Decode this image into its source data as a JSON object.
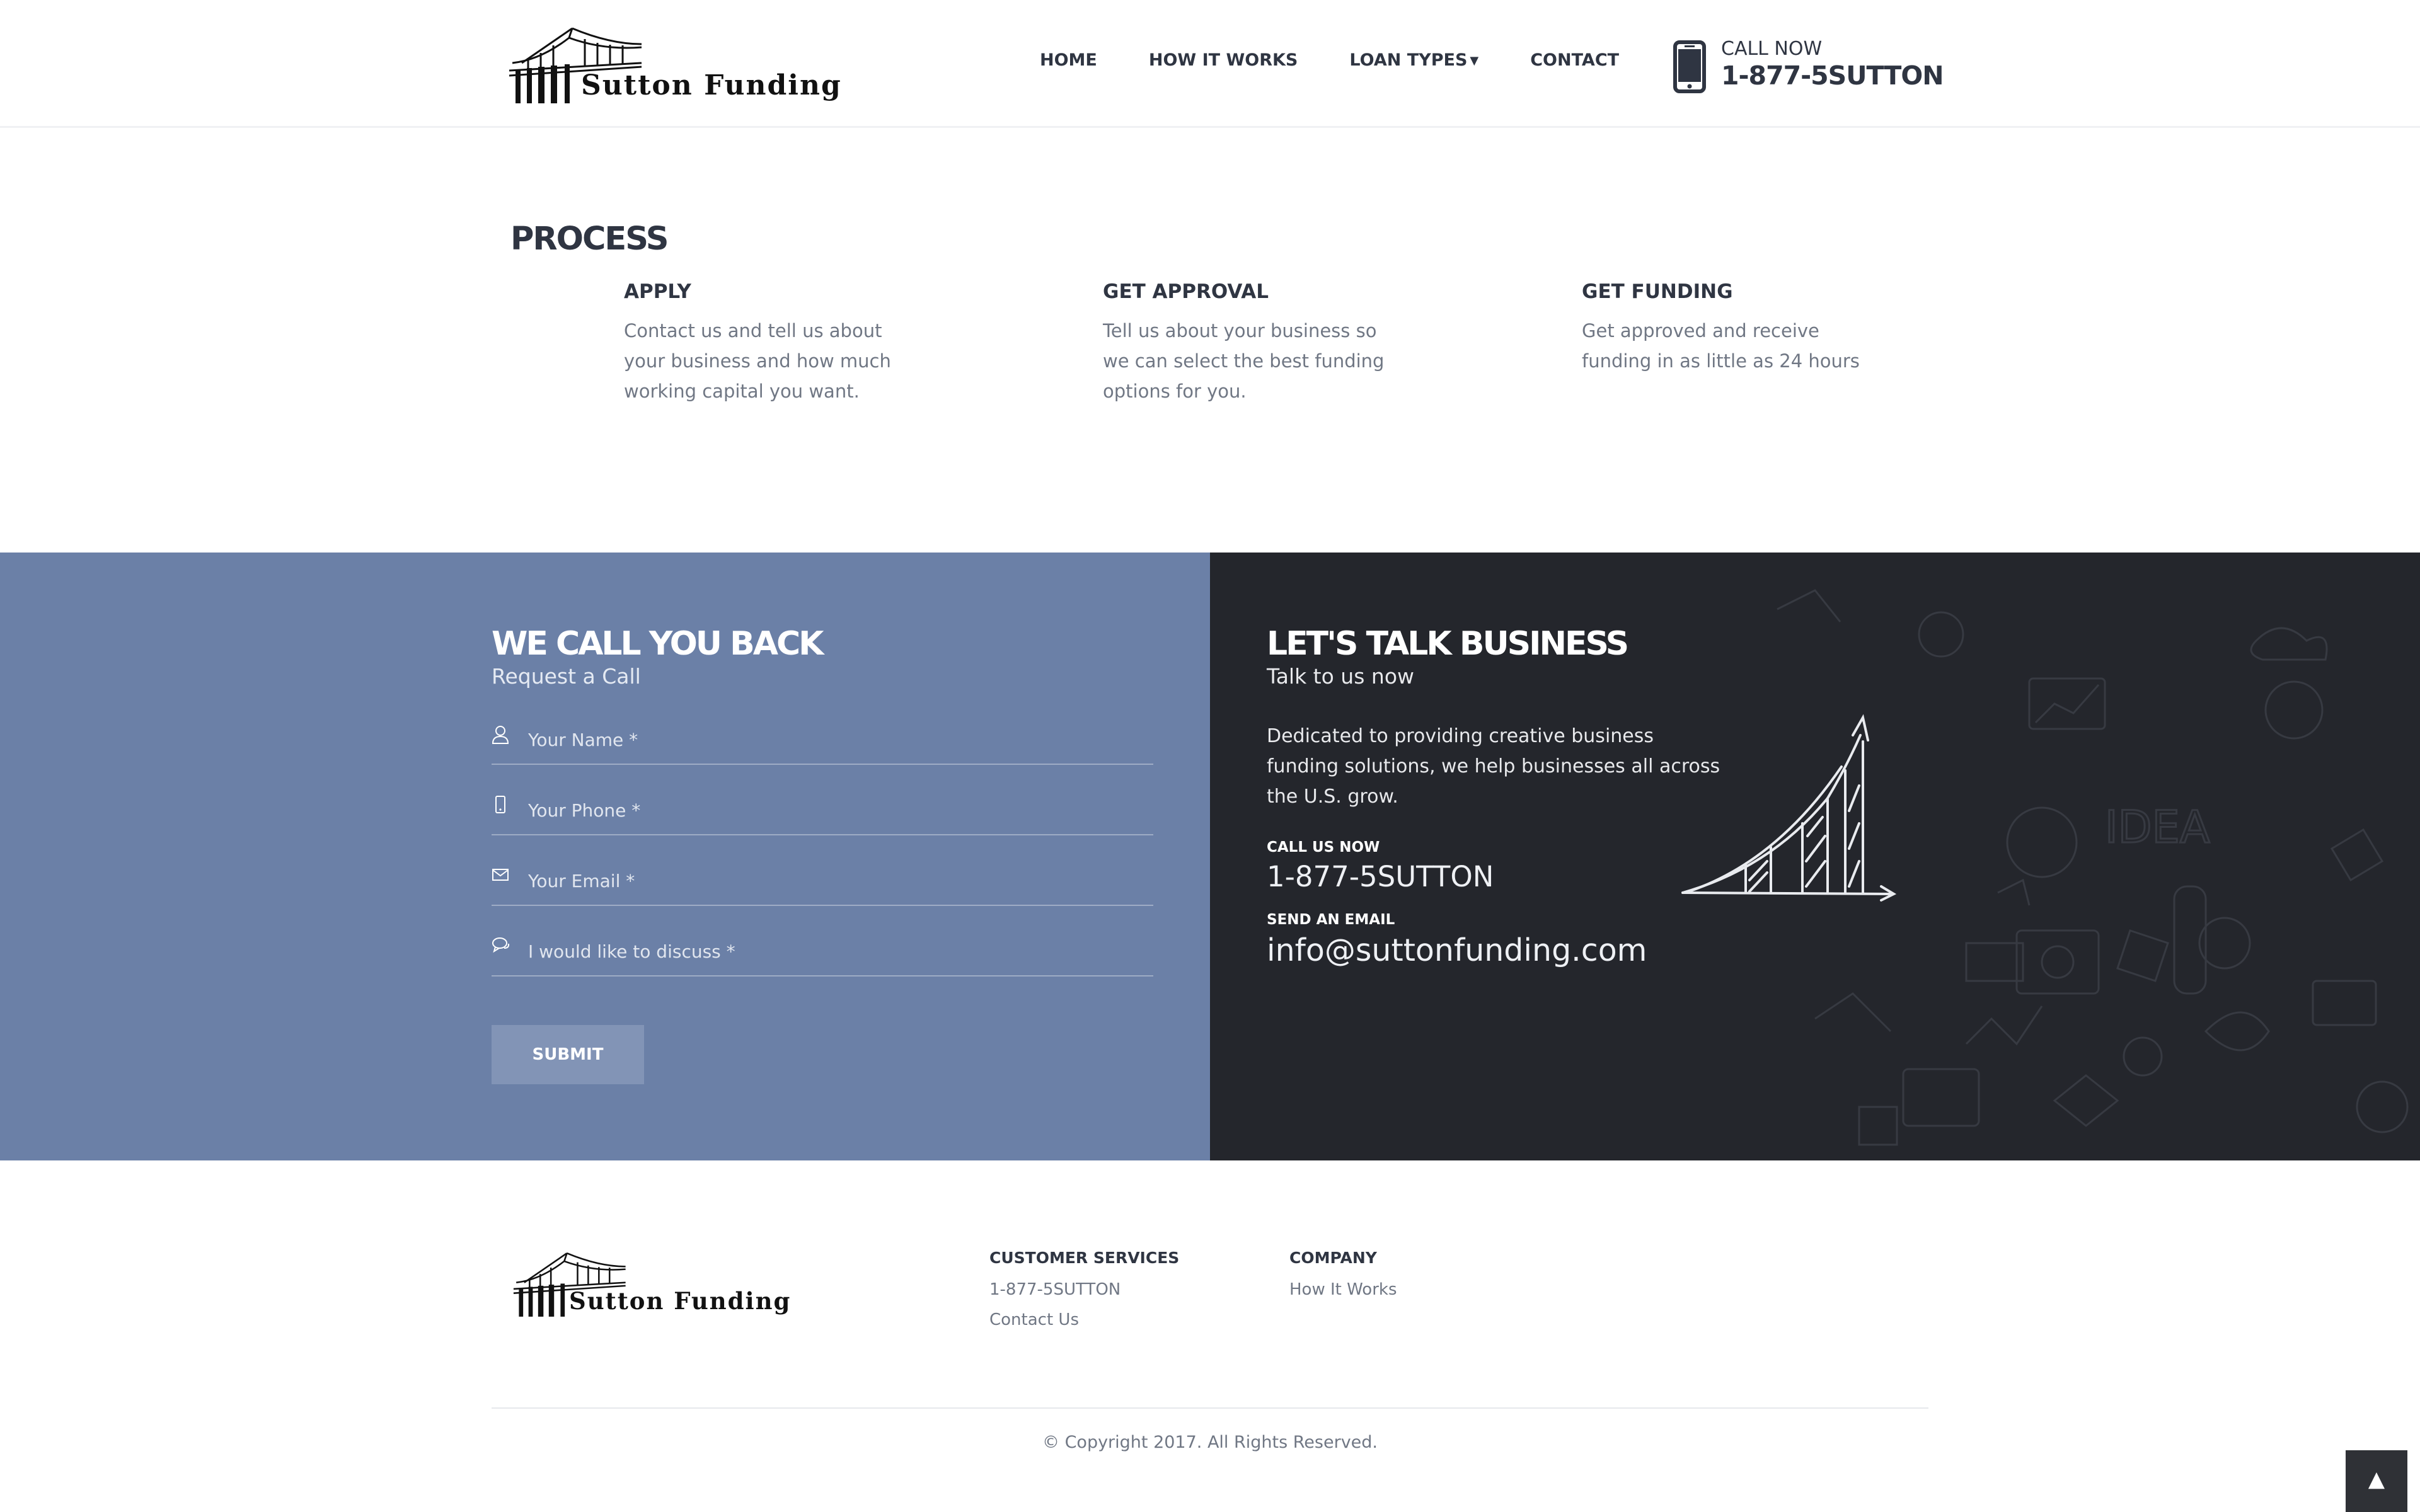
{
  "brand": {
    "name": "Sutton Funding"
  },
  "nav": {
    "items": [
      {
        "label": "HOME"
      },
      {
        "label": "HOW IT WORKS"
      },
      {
        "label": "LOAN TYPES",
        "has_dropdown": true
      },
      {
        "label": "CONTACT"
      }
    ]
  },
  "header_call": {
    "label": "CALL NOW",
    "number": "1-877-5SUTTON"
  },
  "process": {
    "title": "PROCESS",
    "steps": [
      {
        "title": "APPLY",
        "description": "Contact us and tell us about your business and how much working capital you want."
      },
      {
        "title": "GET APPROVAL",
        "description": "Tell us about your business so we can select the best funding options for you."
      },
      {
        "title": "GET FUNDING",
        "description": "Get approved and receive funding in as little as 24 hours"
      }
    ]
  },
  "callback": {
    "title": "WE CALL YOU BACK",
    "subtitle": "Request a Call",
    "fields": [
      {
        "placeholder": "Your Name *",
        "icon": "user-icon"
      },
      {
        "placeholder": "Your Phone *",
        "icon": "phone-icon"
      },
      {
        "placeholder": "Your Email *",
        "icon": "envelope-icon"
      },
      {
        "placeholder": "I would like to discuss *",
        "icon": "chat-icon"
      }
    ],
    "submit_label": "SUBMIT"
  },
  "talk": {
    "title": "LET'S TALK BUSINESS",
    "subtitle": "Talk to us now",
    "description": "Dedicated to providing creative business funding solutions, we help businesses all across the U.S. grow.",
    "call_label": "CALL US NOW",
    "call_number": "1-877-5SUTTON",
    "email_label": "SEND AN EMAIL",
    "email": "info@suttonfunding.com"
  },
  "footer": {
    "columns": [
      {
        "title": "CUSTOMER SERVICES",
        "links": [
          "1-877-5SUTTON",
          "Contact Us"
        ]
      },
      {
        "title": "COMPANY",
        "links": [
          "How It Works"
        ]
      }
    ],
    "copyright": "© Copyright 2017. All Rights Reserved.",
    "back_to_top_icon": "chevron-up-icon"
  },
  "colors": {
    "callback_bg": "#6b80a7",
    "talk_bg": "#24262c",
    "text_dark": "#2f3542",
    "text_muted": "#707784"
  }
}
